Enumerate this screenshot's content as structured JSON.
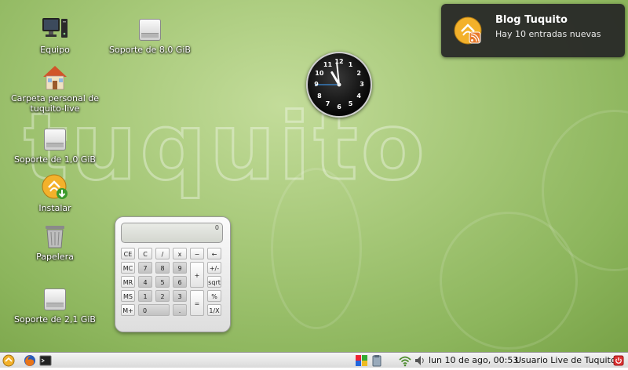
{
  "desktop": {
    "watermark": "tuquito",
    "icons": [
      {
        "label": "Equipo"
      },
      {
        "label": "Soporte de 8,0 GiB"
      },
      {
        "label": "Carpeta personal de tuquito-live"
      },
      {
        "label": "Soporte de 1,0 GiB"
      },
      {
        "label": "Instalar"
      },
      {
        "label": "Papelera"
      },
      {
        "label": "Soporte de 2,1 GiB"
      }
    ]
  },
  "calculator": {
    "display": "0",
    "keys": {
      "ce": "CE",
      "c": "C",
      "div": "/",
      "mul": "x",
      "minus": "−",
      "back": "←",
      "mc": "MC",
      "k7": "7",
      "k8": "8",
      "k9": "9",
      "plus": "+",
      "sign": "+/-",
      "mr": "MR",
      "k4": "4",
      "k5": "5",
      "k6": "6",
      "sqrt": "sqrt",
      "ms": "MS",
      "k1": "1",
      "k2": "2",
      "k3": "3",
      "eq": "=",
      "pct": "%",
      "mplus": "M+",
      "k0": "0",
      "dot": ".",
      "inv": "1/X"
    }
  },
  "clock": {
    "numbers": [
      "12",
      "1",
      "2",
      "3",
      "4",
      "5",
      "6",
      "7",
      "8",
      "9",
      "10",
      "11"
    ],
    "hour": 10,
    "minute": 59,
    "second": 45
  },
  "notification": {
    "title": "Blog Tuquito",
    "body": "Hay 10 entradas nuevas",
    "icon": "rss-feed-icon"
  },
  "panel": {
    "datetime": "lun 10 de ago, 00:53",
    "user": "Usuario Live de Tuquito",
    "icons": [
      "menu-icon",
      "firefox-icon",
      "terminal-icon",
      "update-icon",
      "clipboard-icon",
      "network-icon",
      "volume-icon",
      "power-icon"
    ]
  },
  "colors": {
    "desktop": "#a6c878",
    "accent": "#f3a52b",
    "panel": "#e6e6e6"
  }
}
